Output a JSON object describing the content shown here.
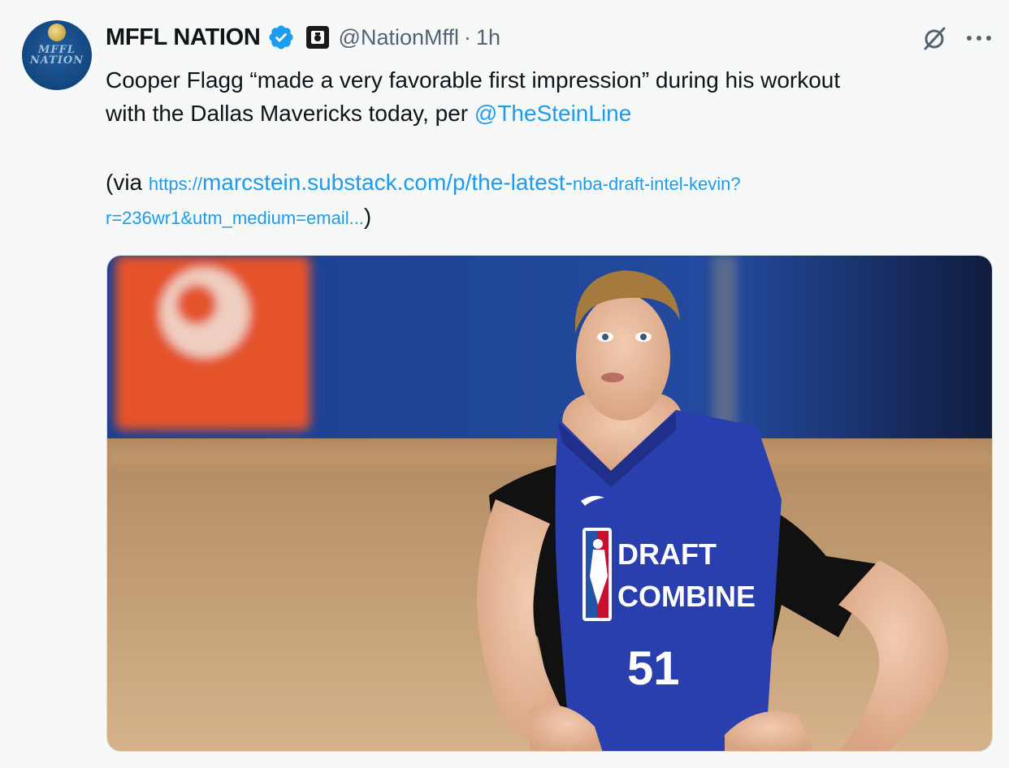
{
  "tweet": {
    "display_name": "MFFL NATION",
    "handle": "@NationMffl",
    "separator": "·",
    "time": "1h",
    "text_line1": "Cooper Flagg “made a very favorable first impression” during his workout",
    "text_line2_prefix": "with the Dallas Mavericks today, per ",
    "mention": "@TheSteinLine",
    "via_prefix": "(via ",
    "link_part1": "https://marcstein.substack.com/p/the-latest-",
    "link_part2": "nba-draft-intel-kevin?",
    "link_line2": "r=236wr1&utm_medium=email...",
    "via_suffix": ")"
  },
  "avatar": {
    "text": "MFFL NATION"
  },
  "media": {
    "jersey_line1": "DRAFT",
    "jersey_line2": "COMBINE",
    "jersey_number": "51"
  },
  "icons": {
    "verified": "verified-badge-icon",
    "affiliate": "affiliate-badge-icon",
    "grok": "grok-icon",
    "more": "more-options-icon"
  },
  "colors": {
    "link": "#1d9bf0",
    "secondary_text": "#536471",
    "verified": "#1d9bf0"
  }
}
